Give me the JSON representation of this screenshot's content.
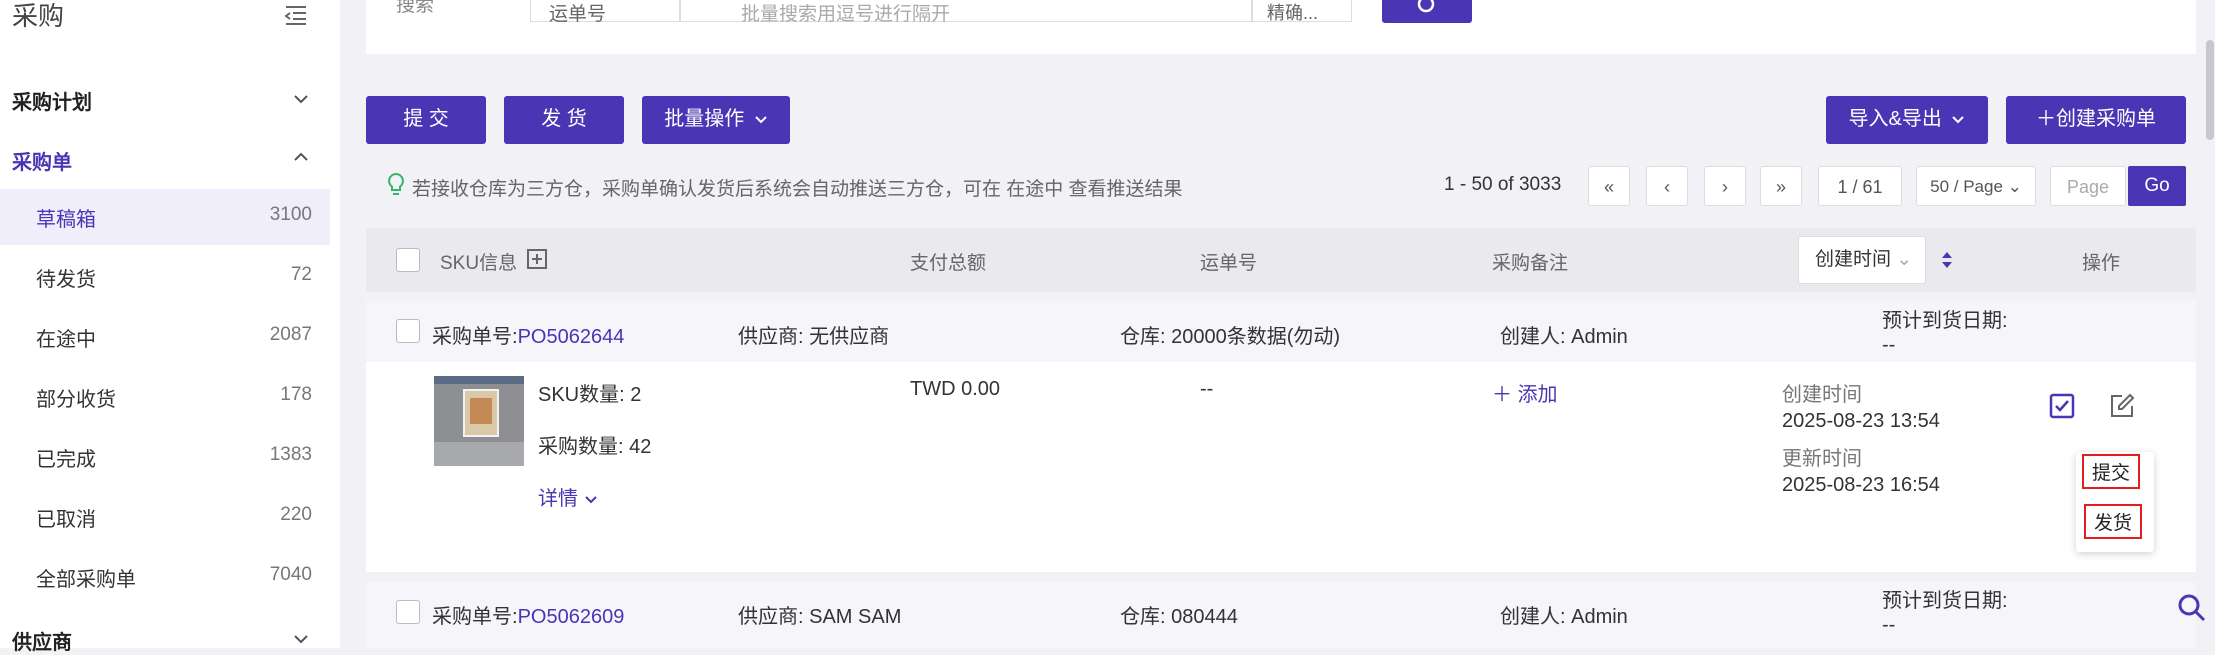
{
  "sidebar": {
    "title": "采购",
    "groups": {
      "plan": "采购计划",
      "order": "采购单",
      "supplier": "供应商"
    },
    "items": [
      {
        "label": "草稿箱",
        "count": "3100"
      },
      {
        "label": "待发货",
        "count": "72"
      },
      {
        "label": "在途中",
        "count": "2087"
      },
      {
        "label": "部分收货",
        "count": "178"
      },
      {
        "label": "已完成",
        "count": "1383"
      },
      {
        "label": "已取消",
        "count": "220"
      },
      {
        "label": "全部采购单",
        "count": "7040"
      }
    ]
  },
  "search": {
    "label": "搜索",
    "field_select": "运单号",
    "placeholder": "批量搜索用逗号进行隔开",
    "match_select": "精确..."
  },
  "toolbar": {
    "submit": "提 交",
    "ship": "发 货",
    "batch": "批量操作",
    "import_export": "导入&导出",
    "create": "创建采购单"
  },
  "tip": "若接收仓库为三方仓，采购单确认发货后系统会自动推送三方仓，可在 在途中 查看推送结果",
  "pager": {
    "range": "1 - 50 of 3033",
    "page": "1 / 61",
    "per_page": "50 / Page",
    "page_placeholder": "Page",
    "go": "Go"
  },
  "table": {
    "headers": {
      "sku": "SKU信息",
      "pay": "支付总额",
      "waybill": "运单号",
      "remark": "采购备注",
      "created": "创建时间",
      "action": "操作"
    }
  },
  "orders": [
    {
      "no_label": "采购单号:",
      "no": "PO5062644",
      "supplier": "供应商: 无供应商",
      "warehouse": "仓库: 20000条数据(勿动)",
      "creator": "创建人: Admin",
      "eta_label": "预计到货日期:",
      "eta": "--",
      "sku_count": "SKU数量: 2",
      "qty": "采购数量: 42",
      "detail": "详情",
      "pay": "TWD 0.00",
      "waybill": "--",
      "add": "添加",
      "created_label": "创建时间",
      "created": "2025-08-23 13:54",
      "updated_label": "更新时间",
      "updated": "2025-08-23 16:54",
      "popup_submit": "提交",
      "popup_ship": "发货"
    },
    {
      "no_label": "采购单号:",
      "no": "PO5062609",
      "supplier": "供应商: SAM SAM",
      "warehouse": "仓库: 080444",
      "creator": "创建人: Admin",
      "eta_label": "预计到货日期:",
      "eta": "--"
    }
  ],
  "colors": {
    "accent": "#4a35b4",
    "highlight": "#e02020"
  }
}
